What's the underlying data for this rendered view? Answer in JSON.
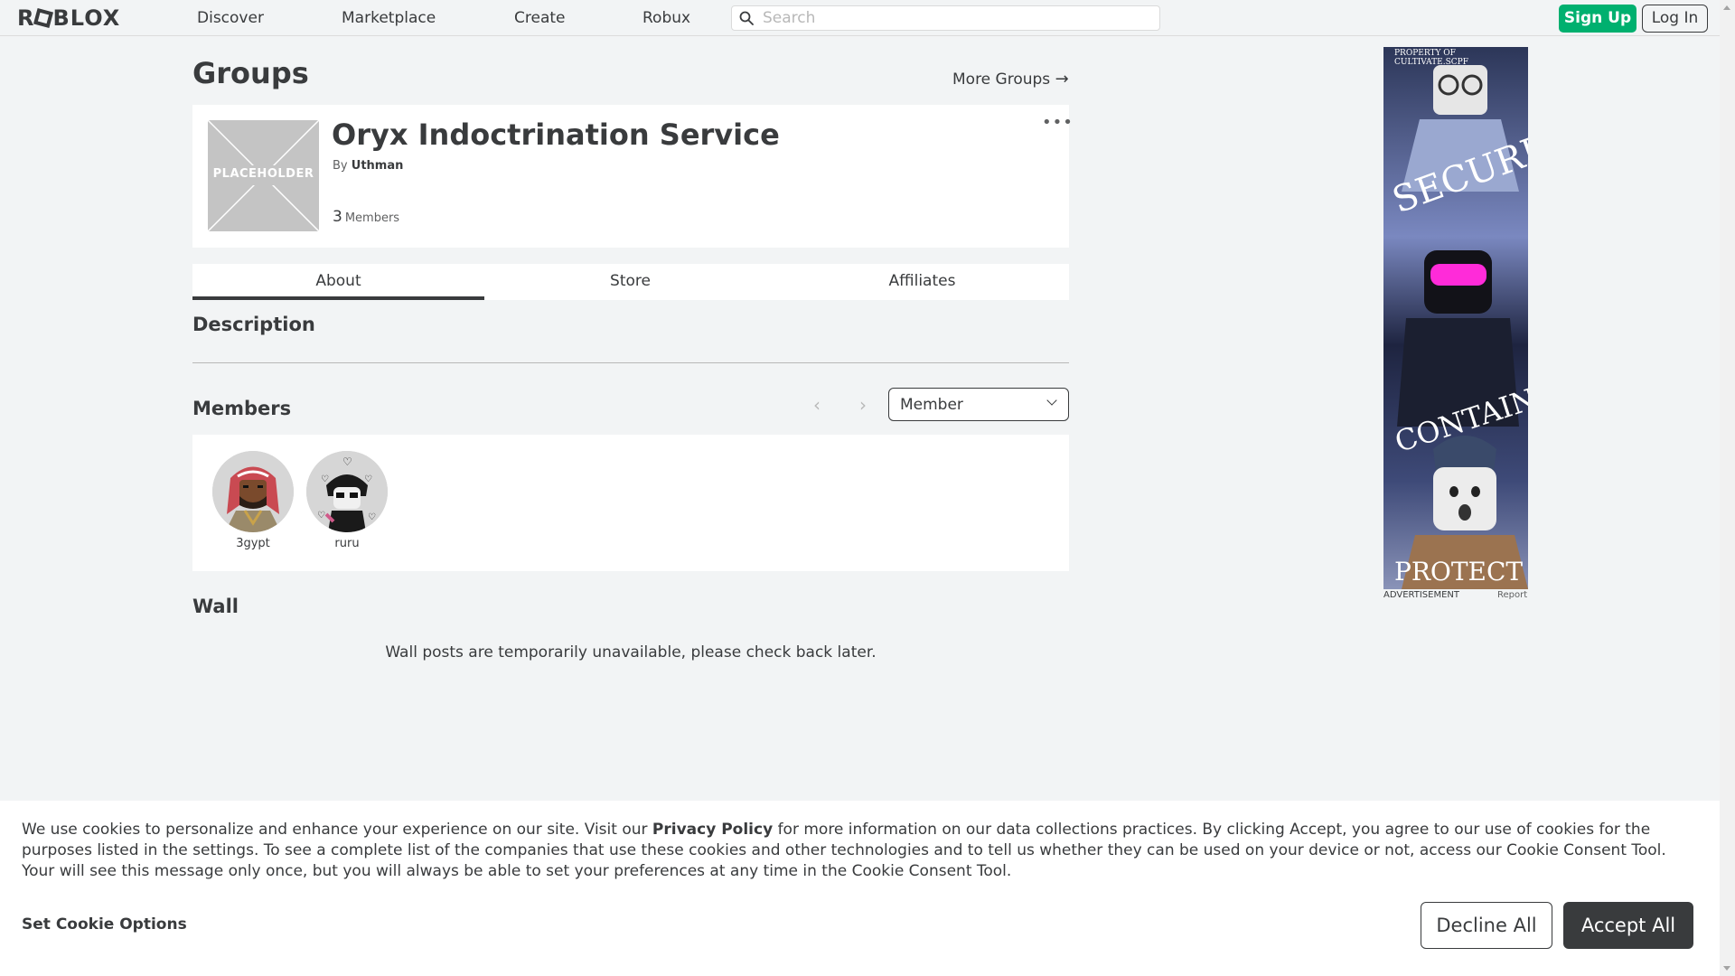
{
  "nav": {
    "logo": "ROBLOX",
    "links": [
      "Discover",
      "Marketplace",
      "Create",
      "Robux"
    ],
    "search_placeholder": "Search",
    "signup": "Sign Up",
    "login": "Log In"
  },
  "page": {
    "title": "Groups",
    "more_groups": "More Groups",
    "more_groups_arrow": "→"
  },
  "group": {
    "icon_placeholder": "PLACEHOLDER",
    "name": "Oryx Indoctrination Service",
    "by_prefix": "By",
    "owner": "Uthman",
    "member_count": "3",
    "members_label": "Members",
    "menu_icon": "ellipsis-icon"
  },
  "tabs": [
    "About",
    "Store",
    "Affiliates"
  ],
  "active_tab": "About",
  "sections": {
    "description": "Description",
    "members": "Members",
    "wall": "Wall"
  },
  "members": {
    "role_filter": "Member",
    "list": [
      {
        "name": "3gypt"
      },
      {
        "name": "ruru"
      }
    ]
  },
  "wall": {
    "message": "Wall posts are temporarily unavailable, please check back later."
  },
  "ad": {
    "label": "ADVERTISEMENT",
    "report": "Report",
    "texts": [
      "PROPERTY OF CULTIVATE.SCPF",
      "SECURE",
      "CONTAIN",
      "PROTECT"
    ]
  },
  "cookie": {
    "text_before": "We use cookies to personalize and enhance your experience on our site. Visit our ",
    "privacy_link": "Privacy Policy",
    "text_after": " for more information on our data collections practices. By clicking Accept, you agree to our use of cookies for the purposes listed in the settings. To see a complete list of the companies that use these cookies and other technologies and to tell us whether they can be used on your device or not, access our Cookie Consent Tool. Your will see this message only once, but you will always be able to set your preferences at any time in the Cookie Consent Tool.",
    "set_options": "Set Cookie Options",
    "decline": "Decline All",
    "accept": "Accept All"
  },
  "colors": {
    "background": "#f2f4f5",
    "text": "#393b3d",
    "signup_green": "#00b06f",
    "accept_dark": "#393b3d"
  }
}
